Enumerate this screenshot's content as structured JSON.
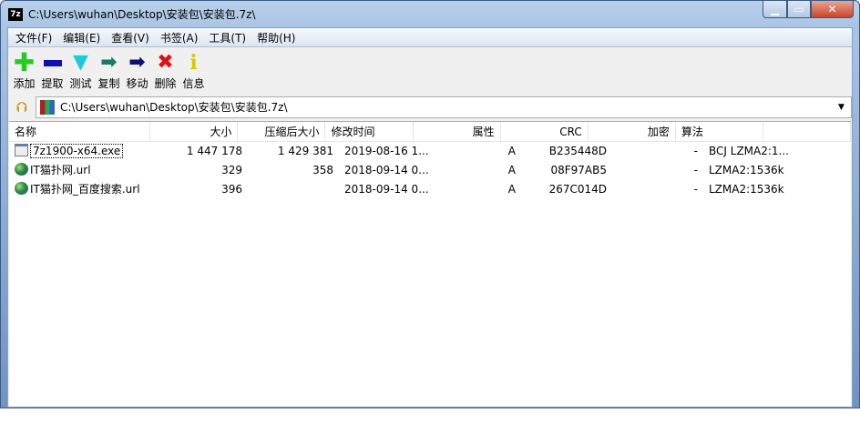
{
  "window": {
    "title": "C:\\Users\\wuhan\\Desktop\\安装包\\安装包.7z\\",
    "app_icon": "7z"
  },
  "menu": [
    "文件(F)",
    "编辑(E)",
    "查看(V)",
    "书签(A)",
    "工具(T)",
    "帮助(H)"
  ],
  "toolbar": [
    {
      "label": "添加",
      "icon": "plus-icon",
      "color": "#22cc22"
    },
    {
      "label": "提取",
      "icon": "minus-icon",
      "color": "#1010b0"
    },
    {
      "label": "测试",
      "icon": "check-chevron-icon",
      "color": "#22c8d8"
    },
    {
      "label": "复制",
      "icon": "copy-arrow-icon",
      "color": "#1a7a6a"
    },
    {
      "label": "移动",
      "icon": "move-arrow-icon",
      "color": "#101070"
    },
    {
      "label": "删除",
      "icon": "delete-x-icon",
      "color": "#dd1111"
    },
    {
      "label": "信息",
      "icon": "info-icon",
      "color": "#d8c800"
    }
  ],
  "address": {
    "value": "C:\\Users\\wuhan\\Desktop\\安装包\\安装包.7z\\"
  },
  "columns": [
    "名称",
    "大小",
    "压缩后大小",
    "修改时间",
    "属性",
    "CRC",
    "加密",
    "算法"
  ],
  "rows": [
    {
      "name": "7z1900-x64.exe",
      "icon": "exe",
      "size": "1 447 178",
      "packed": "1 429 381",
      "modified": "2019-08-16 1...",
      "attr": "A",
      "crc": "B235448D",
      "enc": "-",
      "method": "BCJ LZMA2:1..."
    },
    {
      "name": "IT猫扑网.url",
      "icon": "url",
      "size": "329",
      "packed": "358",
      "modified": "2018-09-14 0...",
      "attr": "A",
      "crc": "08F97AB5",
      "enc": "-",
      "method": "LZMA2:1536k"
    },
    {
      "name": "IT猫扑网_百度搜索.url",
      "icon": "url",
      "size": "396",
      "packed": "",
      "modified": "2018-09-14 0...",
      "attr": "A",
      "crc": "267C014D",
      "enc": "-",
      "method": "LZMA2:1536k"
    }
  ]
}
